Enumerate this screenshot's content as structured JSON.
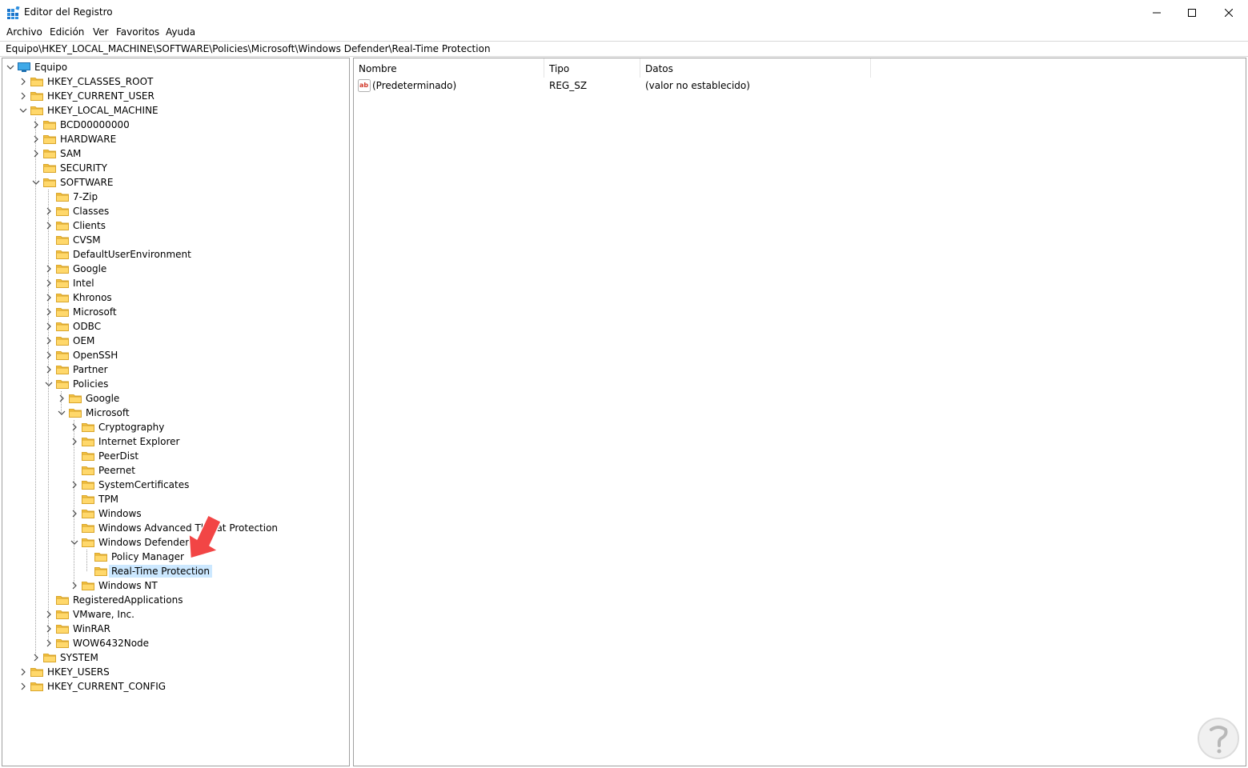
{
  "window": {
    "title": "Editor del Registro",
    "colors": {
      "selection": "#cce8ff",
      "folder": "#f5c342",
      "arrow": "#f24545"
    }
  },
  "menu": [
    "Archivo",
    "Edición",
    "Ver",
    "Favoritos",
    "Ayuda"
  ],
  "address": "Equipo\\HKEY_LOCAL_MACHINE\\SOFTWARE\\Policies\\Microsoft\\Windows Defender\\Real-Time Protection",
  "tree": [
    {
      "label": "Equipo",
      "depth": 0,
      "expander": "expanded",
      "icon": "computer-icon"
    },
    {
      "label": "HKEY_CLASSES_ROOT",
      "depth": 1,
      "expander": "collapsed"
    },
    {
      "label": "HKEY_CURRENT_USER",
      "depth": 1,
      "expander": "collapsed"
    },
    {
      "label": "HKEY_LOCAL_MACHINE",
      "depth": 1,
      "expander": "expanded"
    },
    {
      "label": "BCD00000000",
      "depth": 2,
      "expander": "collapsed"
    },
    {
      "label": "HARDWARE",
      "depth": 2,
      "expander": "collapsed"
    },
    {
      "label": "SAM",
      "depth": 2,
      "expander": "collapsed"
    },
    {
      "label": "SECURITY",
      "depth": 2,
      "expander": "none"
    },
    {
      "label": "SOFTWARE",
      "depth": 2,
      "expander": "expanded"
    },
    {
      "label": "7-Zip",
      "depth": 3,
      "expander": "none"
    },
    {
      "label": "Classes",
      "depth": 3,
      "expander": "collapsed"
    },
    {
      "label": "Clients",
      "depth": 3,
      "expander": "collapsed"
    },
    {
      "label": "CVSM",
      "depth": 3,
      "expander": "none"
    },
    {
      "label": "DefaultUserEnvironment",
      "depth": 3,
      "expander": "none"
    },
    {
      "label": "Google",
      "depth": 3,
      "expander": "collapsed"
    },
    {
      "label": "Intel",
      "depth": 3,
      "expander": "collapsed"
    },
    {
      "label": "Khronos",
      "depth": 3,
      "expander": "collapsed"
    },
    {
      "label": "Microsoft",
      "depth": 3,
      "expander": "collapsed"
    },
    {
      "label": "ODBC",
      "depth": 3,
      "expander": "collapsed"
    },
    {
      "label": "OEM",
      "depth": 3,
      "expander": "collapsed"
    },
    {
      "label": "OpenSSH",
      "depth": 3,
      "expander": "collapsed"
    },
    {
      "label": "Partner",
      "depth": 3,
      "expander": "collapsed"
    },
    {
      "label": "Policies",
      "depth": 3,
      "expander": "expanded"
    },
    {
      "label": "Google",
      "depth": 4,
      "expander": "collapsed"
    },
    {
      "label": "Microsoft",
      "depth": 4,
      "expander": "expanded"
    },
    {
      "label": "Cryptography",
      "depth": 5,
      "expander": "collapsed"
    },
    {
      "label": "Internet Explorer",
      "depth": 5,
      "expander": "collapsed"
    },
    {
      "label": "PeerDist",
      "depth": 5,
      "expander": "none"
    },
    {
      "label": "Peernet",
      "depth": 5,
      "expander": "none"
    },
    {
      "label": "SystemCertificates",
      "depth": 5,
      "expander": "collapsed"
    },
    {
      "label": "TPM",
      "depth": 5,
      "expander": "none"
    },
    {
      "label": "Windows",
      "depth": 5,
      "expander": "collapsed"
    },
    {
      "label": "Windows Advanced Threat Protection",
      "depth": 5,
      "expander": "none"
    },
    {
      "label": "Windows Defender",
      "depth": 5,
      "expander": "expanded"
    },
    {
      "label": "Policy Manager",
      "depth": 6,
      "expander": "none"
    },
    {
      "label": "Real-Time Protection",
      "depth": 6,
      "expander": "none",
      "selected": true
    },
    {
      "label": "Windows NT",
      "depth": 5,
      "expander": "collapsed"
    },
    {
      "label": "RegisteredApplications",
      "depth": 3,
      "expander": "none"
    },
    {
      "label": "VMware, Inc.",
      "depth": 3,
      "expander": "collapsed"
    },
    {
      "label": "WinRAR",
      "depth": 3,
      "expander": "collapsed"
    },
    {
      "label": "WOW6432Node",
      "depth": 3,
      "expander": "collapsed"
    },
    {
      "label": "SYSTEM",
      "depth": 2,
      "expander": "collapsed"
    },
    {
      "label": "HKEY_USERS",
      "depth": 1,
      "expander": "collapsed"
    },
    {
      "label": "HKEY_CURRENT_CONFIG",
      "depth": 1,
      "expander": "collapsed"
    }
  ],
  "list": {
    "columns": [
      "Nombre",
      "Tipo",
      "Datos"
    ],
    "rows": [
      {
        "name": "(Predeterminado)",
        "type": "REG_SZ",
        "data": "(valor no establecido)",
        "icon": "string-value-icon"
      }
    ]
  }
}
